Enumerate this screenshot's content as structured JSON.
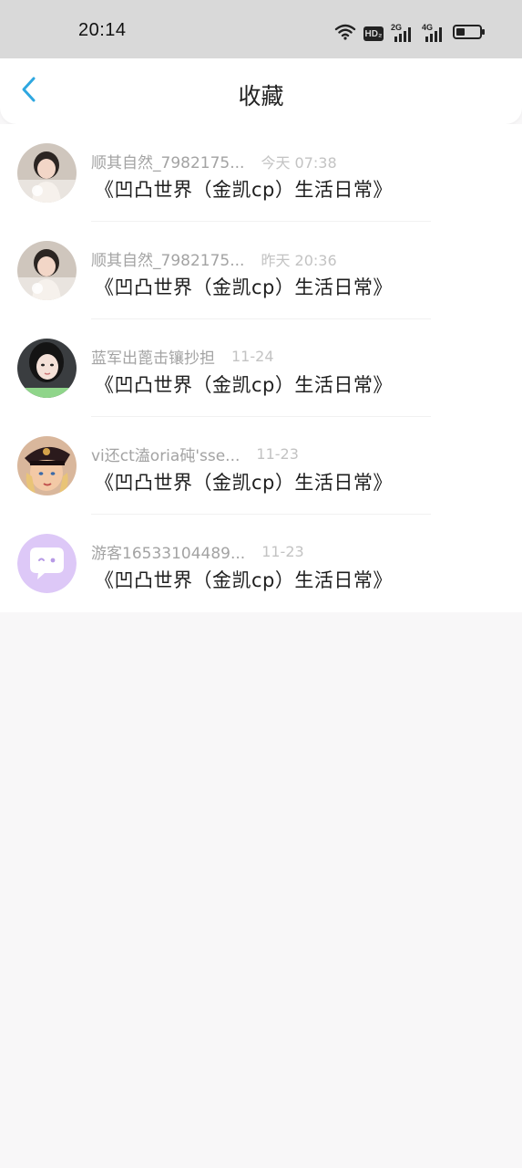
{
  "status_bar": {
    "time": "20:14",
    "icons": [
      "wifi-icon",
      "hd-icon",
      "signal-2g-icon",
      "signal-4g-icon",
      "battery-icon"
    ],
    "hd_label": "HD₂",
    "net1_label": "2G",
    "net2_label": "4G"
  },
  "header": {
    "title": "收藏",
    "back_icon": "chevron-left-icon",
    "accent_color": "#2ea7e0"
  },
  "favorites": [
    {
      "username": "顺其自然_7982175...",
      "time": "今天 07:38",
      "title": "《凹凸世界（金凯cp）生活日常》",
      "avatar": "photo-girl-1"
    },
    {
      "username": "顺其自然_7982175...",
      "time": "昨天 20:36",
      "title": "《凹凸世界（金凯cp）生活日常》",
      "avatar": "photo-girl-1"
    },
    {
      "username": "蓝军出蓖击镶抄担",
      "time": "11-24",
      "title": "《凹凸世界（金凯cp）生活日常》",
      "avatar": "photo-girl-2"
    },
    {
      "username": "vi还ct溘oria砘'sse...",
      "time": "11-23",
      "title": "《凹凸世界（金凯cp）生活日常》",
      "avatar": "photo-child-captain"
    },
    {
      "username": "游客16533104489...",
      "time": "11-23",
      "title": "《凹凸世界（金凯cp）生活日常》",
      "avatar": "default-chat-avatar"
    }
  ]
}
